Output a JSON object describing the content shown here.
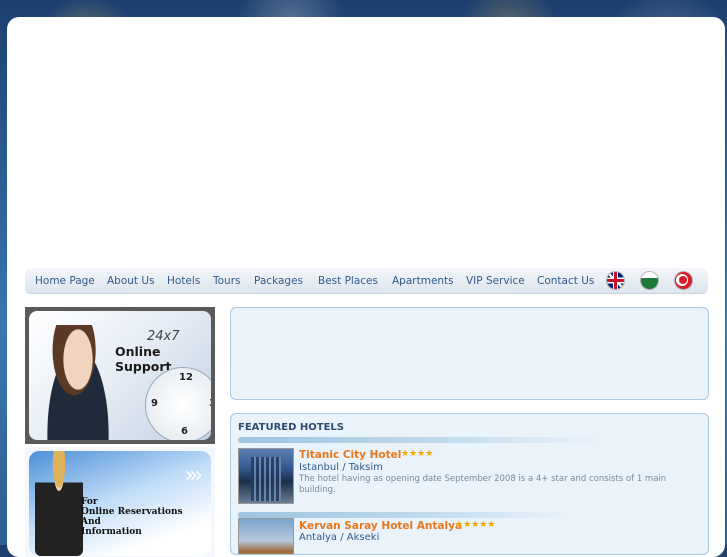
{
  "nav": {
    "items": [
      {
        "label": "Home Page"
      },
      {
        "label": "About Us"
      },
      {
        "label": "Hotels"
      },
      {
        "label": "Tours"
      },
      {
        "label": "Packages"
      },
      {
        "label": "Best Places"
      },
      {
        "label": "Apartments"
      },
      {
        "label": "VIP Service"
      },
      {
        "label": "Contact Us"
      }
    ],
    "flags": [
      "uk-flag-icon",
      "saudi-flag-icon",
      "turkey-flag-icon"
    ]
  },
  "ads": {
    "support": {
      "line1": "24x7",
      "line2": "Online Support",
      "clock_numbers": [
        "12",
        "9",
        "3",
        "6"
      ]
    },
    "reservations": {
      "line1": "For",
      "line2": "Online Reservations",
      "line3": "And",
      "line4": "Information"
    }
  },
  "featured": {
    "title": "FEATURED HOTELS",
    "hotels": [
      {
        "name": "Titanic City Hotel",
        "stars": "★★★★",
        "location": "Istanbul / Taksim",
        "description": "The hotel having as opening date September 2008 is a 4+ star and consists of 1 main building."
      },
      {
        "name": "Kervan Saray Hotel Antalya",
        "stars": "★★★★★",
        "location": "Antalya / Akseki",
        "description": ""
      }
    ]
  },
  "colors": {
    "nav_text": "#2f5b8c",
    "hotel_name": "#e8771c",
    "star": "#f0a800",
    "box_bg": "#eaf2fa",
    "box_border": "#a9c8e3"
  }
}
